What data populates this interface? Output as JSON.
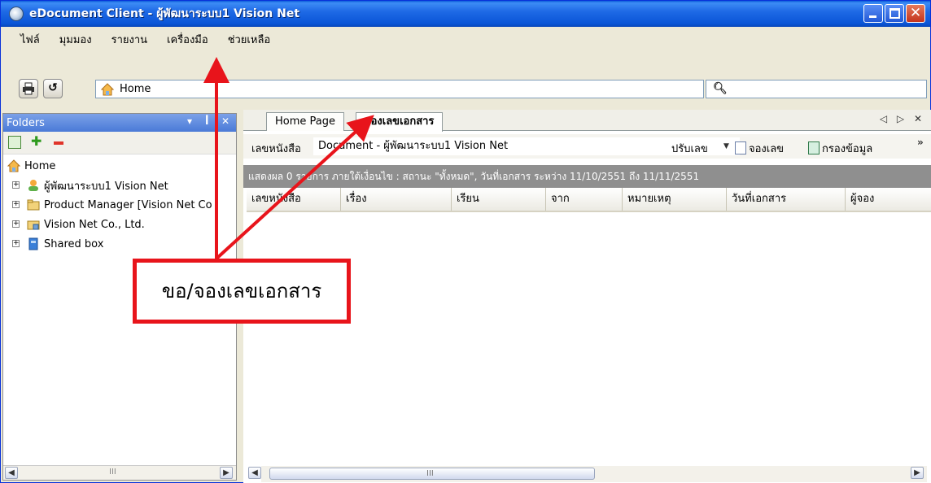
{
  "window": {
    "title": "eDocument Client - ผู้พัฒนาระบบ1 Vision Net"
  },
  "menu": [
    "ไฟล์",
    "มุมมอง",
    "รายงาน",
    "เครื่องมือ",
    "ช่วยเหลือ"
  ],
  "address": {
    "text": "Home"
  },
  "folders": {
    "header": "Folders",
    "tree": [
      {
        "label": "Home",
        "icon": "home-icon"
      },
      {
        "label": "ผู้พัฒนาระบบ1 Vision Net",
        "icon": "user-icon"
      },
      {
        "label": "Product Manager [Vision Net Co",
        "icon": "folder-icon"
      },
      {
        "label": "Vision Net Co., Ltd.",
        "icon": "folder-network-icon"
      },
      {
        "label": "Shared box",
        "icon": "shared-box-icon"
      }
    ]
  },
  "tabs": [
    {
      "label": "Home Page"
    },
    {
      "label": "จองเลขเอกสาร"
    }
  ],
  "doc_toolbar": {
    "field_label": "เลขหนังสือ",
    "select_value": "Document - ผู้พัฒนาระบบ1 Vision Net",
    "adjust_label": "ปรับเลข",
    "reserve_label": "จองเลข",
    "filter_label": "กรองข้อมูล"
  },
  "status_text": "แสดงผล 0 รายการ ภายใต้เงื่อนไข : สถานะ \"ทั้งหมด\", วันที่เอกสาร ระหว่าง 11/10/2551 ถึง 11/11/2551",
  "columns": [
    "เลขหนังสือ",
    "เรื่อง",
    "เรียน",
    "จาก",
    "หมายเหตุ",
    "วันที่เอกสาร",
    "ผู้จอง"
  ],
  "annotation": {
    "text": "ขอ/จองเลขเอกสาร",
    "color": "#e8141b"
  }
}
